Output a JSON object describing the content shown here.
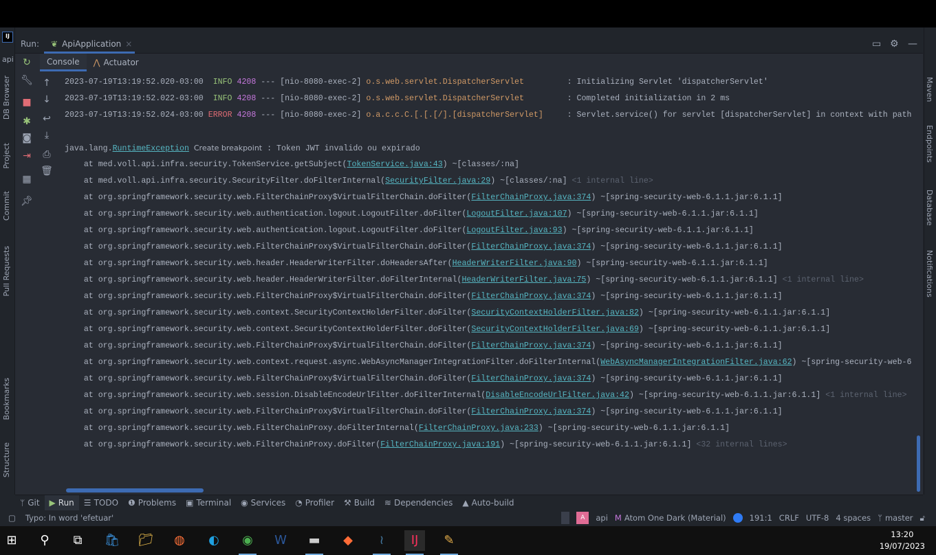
{
  "run_panel": {
    "label": "Run:",
    "tab": "ApiApplication",
    "tab_close": "×"
  },
  "left_strip": {
    "project_label": "api",
    "items": [
      "DB Browser",
      "Project",
      "Commit",
      "Pull Requests",
      "Bookmarks",
      "Structure"
    ]
  },
  "right_strip": {
    "items": [
      "Maven",
      "Endpoints",
      "Database",
      "Notifications"
    ]
  },
  "subtabs": [
    {
      "label": "Console",
      "active": true
    },
    {
      "label": "Actuator",
      "active": false
    }
  ],
  "log_lines": [
    {
      "fold": false,
      "segs": [
        [
          "ts",
          "2023-07-19T13:19:52.020-03:00  "
        ],
        [
          "info",
          "INFO"
        ],
        [
          "ts",
          " "
        ],
        [
          "pid",
          "4208"
        ],
        [
          "ts",
          " --- [nio-8080-exec-2] "
        ],
        [
          "cls",
          "o.s.web.servlet.DispatcherServlet       "
        ],
        [
          "ts",
          "  : Initializing Servlet 'dispatcherServlet'"
        ]
      ]
    },
    {
      "fold": false,
      "segs": [
        [
          "ts",
          "2023-07-19T13:19:52.022-03:00  "
        ],
        [
          "info",
          "INFO"
        ],
        [
          "ts",
          " "
        ],
        [
          "pid",
          "4208"
        ],
        [
          "ts",
          " --- [nio-8080-exec-2] "
        ],
        [
          "cls",
          "o.s.web.servlet.DispatcherServlet       "
        ],
        [
          "ts",
          "  : Completed initialization in 2 ms"
        ]
      ]
    },
    {
      "fold": false,
      "segs": [
        [
          "ts",
          "2023-07-19T13:19:52.024-03:00 "
        ],
        [
          "err",
          "ERROR"
        ],
        [
          "ts",
          " "
        ],
        [
          "pid",
          "4208"
        ],
        [
          "ts",
          " --- [nio-8080-exec-2] "
        ],
        [
          "cls",
          "o.a.c.c.C.[.[.[/].[dispatcherServlet]   "
        ],
        [
          "ts",
          "  : Servlet.service() for servlet [dispatcherServlet] in context with path"
        ]
      ]
    },
    {
      "fold": false,
      "segs": []
    },
    {
      "fold": false,
      "segs": [
        [
          "ts",
          "java.lang."
        ],
        [
          "lnk",
          "RuntimeException"
        ],
        [
          "ts",
          " "
        ],
        [
          "bp",
          "Create breakpoint"
        ],
        [
          "ts",
          " : Token JWT invalido ou expirado"
        ]
      ]
    },
    {
      "fold": false,
      "segs": [
        [
          "ts",
          "    at med.voll.api.infra.security.TokenService.getSubject("
        ],
        [
          "lnk",
          "TokenService.java:43"
        ],
        [
          "ts",
          ") ~[classes/:na]"
        ]
      ]
    },
    {
      "fold": true,
      "segs": [
        [
          "ts",
          "    at med.voll.api.infra.security.SecurityFilter.doFilterInternal("
        ],
        [
          "lnk",
          "SecurityFilter.java:29"
        ],
        [
          "ts",
          ") ~[classes/:na] "
        ],
        [
          "gray",
          "<1 internal line>"
        ]
      ]
    },
    {
      "fold": false,
      "segs": [
        [
          "ts",
          "    at org.springframework.security.web.FilterChainProxy$VirtualFilterChain.doFilter("
        ],
        [
          "lnk",
          "FilterChainProxy.java:374"
        ],
        [
          "ts",
          ") ~[spring-security-web-6.1.1.jar:6.1.1]"
        ]
      ]
    },
    {
      "fold": false,
      "segs": [
        [
          "ts",
          "    at org.springframework.security.web.authentication.logout.LogoutFilter.doFilter("
        ],
        [
          "lnk",
          "LogoutFilter.java:107"
        ],
        [
          "ts",
          ") ~[spring-security-web-6.1.1.jar:6.1.1]"
        ]
      ]
    },
    {
      "fold": false,
      "segs": [
        [
          "ts",
          "    at org.springframework.security.web.authentication.logout.LogoutFilter.doFilter("
        ],
        [
          "lnk",
          "LogoutFilter.java:93"
        ],
        [
          "ts",
          ") ~[spring-security-web-6.1.1.jar:6.1.1]"
        ]
      ]
    },
    {
      "fold": false,
      "segs": [
        [
          "ts",
          "    at org.springframework.security.web.FilterChainProxy$VirtualFilterChain.doFilter("
        ],
        [
          "lnk",
          "FilterChainProxy.java:374"
        ],
        [
          "ts",
          ") ~[spring-security-web-6.1.1.jar:6.1.1]"
        ]
      ]
    },
    {
      "fold": false,
      "segs": [
        [
          "ts",
          "    at org.springframework.security.web.header.HeaderWriterFilter.doHeadersAfter("
        ],
        [
          "lnk",
          "HeaderWriterFilter.java:90"
        ],
        [
          "ts",
          ") ~[spring-security-web-6.1.1.jar:6.1.1]"
        ]
      ]
    },
    {
      "fold": true,
      "segs": [
        [
          "ts",
          "    at org.springframework.security.web.header.HeaderWriterFilter.doFilterInternal("
        ],
        [
          "lnk",
          "HeaderWriterFilter.java:75"
        ],
        [
          "ts",
          ") ~[spring-security-web-6.1.1.jar:6.1.1] "
        ],
        [
          "gray",
          "<1 internal line>"
        ]
      ]
    },
    {
      "fold": false,
      "segs": [
        [
          "ts",
          "    at org.springframework.security.web.FilterChainProxy$VirtualFilterChain.doFilter("
        ],
        [
          "lnk",
          "FilterChainProxy.java:374"
        ],
        [
          "ts",
          ") ~[spring-security-web-6.1.1.jar:6.1.1]"
        ]
      ]
    },
    {
      "fold": false,
      "segs": [
        [
          "ts",
          "    at org.springframework.security.web.context.SecurityContextHolderFilter.doFilter("
        ],
        [
          "lnk",
          "SecurityContextHolderFilter.java:82"
        ],
        [
          "ts",
          ") ~[spring-security-web-6.1.1.jar:6.1.1]"
        ]
      ]
    },
    {
      "fold": false,
      "segs": [
        [
          "ts",
          "    at org.springframework.security.web.context.SecurityContextHolderFilter.doFilter("
        ],
        [
          "lnk",
          "SecurityContextHolderFilter.java:69"
        ],
        [
          "ts",
          ") ~[spring-security-web-6.1.1.jar:6.1.1]"
        ]
      ]
    },
    {
      "fold": false,
      "segs": [
        [
          "ts",
          "    at org.springframework.security.web.FilterChainProxy$VirtualFilterChain.doFilter("
        ],
        [
          "lnk",
          "FilterChainProxy.java:374"
        ],
        [
          "ts",
          ") ~[spring-security-web-6.1.1.jar:6.1.1]"
        ]
      ]
    },
    {
      "fold": true,
      "segs": [
        [
          "ts",
          "    at org.springframework.security.web.context.request.async.WebAsyncManagerIntegrationFilter.doFilterInternal("
        ],
        [
          "lnk",
          "WebAsyncManagerIntegrationFilter.java:62"
        ],
        [
          "ts",
          ") ~[spring-security-web-6"
        ]
      ]
    },
    {
      "fold": false,
      "segs": [
        [
          "ts",
          "    at org.springframework.security.web.FilterChainProxy$VirtualFilterChain.doFilter("
        ],
        [
          "lnk",
          "FilterChainProxy.java:374"
        ],
        [
          "ts",
          ") ~[spring-security-web-6.1.1.jar:6.1.1]"
        ]
      ]
    },
    {
      "fold": true,
      "segs": [
        [
          "ts",
          "    at org.springframework.security.web.session.DisableEncodeUrlFilter.doFilterInternal("
        ],
        [
          "lnk",
          "DisableEncodeUrlFilter.java:42"
        ],
        [
          "ts",
          ") ~[spring-security-web-6.1.1.jar:6.1.1] "
        ],
        [
          "gray",
          "<1 internal line>"
        ]
      ]
    },
    {
      "fold": false,
      "segs": [
        [
          "ts",
          "    at org.springframework.security.web.FilterChainProxy$VirtualFilterChain.doFilter("
        ],
        [
          "lnk",
          "FilterChainProxy.java:374"
        ],
        [
          "ts",
          ") ~[spring-security-web-6.1.1.jar:6.1.1]"
        ]
      ]
    },
    {
      "fold": false,
      "segs": [
        [
          "ts",
          "    at org.springframework.security.web.FilterChainProxy.doFilterInternal("
        ],
        [
          "lnk",
          "FilterChainProxy.java:233"
        ],
        [
          "ts",
          ") ~[spring-security-web-6.1.1.jar:6.1.1]"
        ]
      ]
    },
    {
      "fold": true,
      "segs": [
        [
          "ts",
          "    at org.springframework.security.web.FilterChainProxy.doFilter("
        ],
        [
          "lnk",
          "FilterChainProxy.java:191"
        ],
        [
          "ts",
          ") ~[spring-security-web-6.1.1.jar:6.1.1] "
        ],
        [
          "gray",
          "<32 internal lines>"
        ]
      ]
    }
  ],
  "tool_windows": [
    {
      "icon": "git-icon",
      "glyph": "ᛘ",
      "label": "Git"
    },
    {
      "icon": "run-icon",
      "glyph": "▶",
      "label": "Run",
      "active": true
    },
    {
      "icon": "todo-icon",
      "glyph": "☰",
      "label": "TODO"
    },
    {
      "icon": "problems-icon",
      "glyph": "❶",
      "label": "Problems"
    },
    {
      "icon": "terminal-icon",
      "glyph": "▣",
      "label": "Terminal"
    },
    {
      "icon": "services-icon",
      "glyph": "◉",
      "label": "Services"
    },
    {
      "icon": "profiler-icon",
      "glyph": "◔",
      "label": "Profiler"
    },
    {
      "icon": "build-icon",
      "glyph": "⚒",
      "label": "Build"
    },
    {
      "icon": "dependencies-icon",
      "glyph": "≋",
      "label": "Dependencies"
    },
    {
      "icon": "warning-icon",
      "glyph": "▲",
      "label": "Auto-build"
    }
  ],
  "status": {
    "message": "Typo: In word 'efetuar'",
    "project": "api",
    "avatar_letter": "A",
    "theme": "Atom One Dark (Material)",
    "position": "191:1",
    "line_sep": "CRLF",
    "encoding": "UTF-8",
    "indent": "4 spaces",
    "branch": "master"
  },
  "taskbar": {
    "time": "13:20",
    "date": "19/07/2023",
    "apps": [
      "windows-start",
      "search",
      "task-view",
      "microsoft-store",
      "file-explorer",
      "firefox",
      "edge",
      "chrome",
      "word",
      "terminal",
      "postman",
      "mysql-workbench",
      "intellij",
      "paint"
    ]
  },
  "colors": {
    "background": "#282c34",
    "panel": "#21252b",
    "accent": "#3d6bb3",
    "info": "#98c379",
    "error": "#e06c75",
    "pid": "#c678dd",
    "logger": "#d19a66",
    "link": "#56b6c2"
  }
}
